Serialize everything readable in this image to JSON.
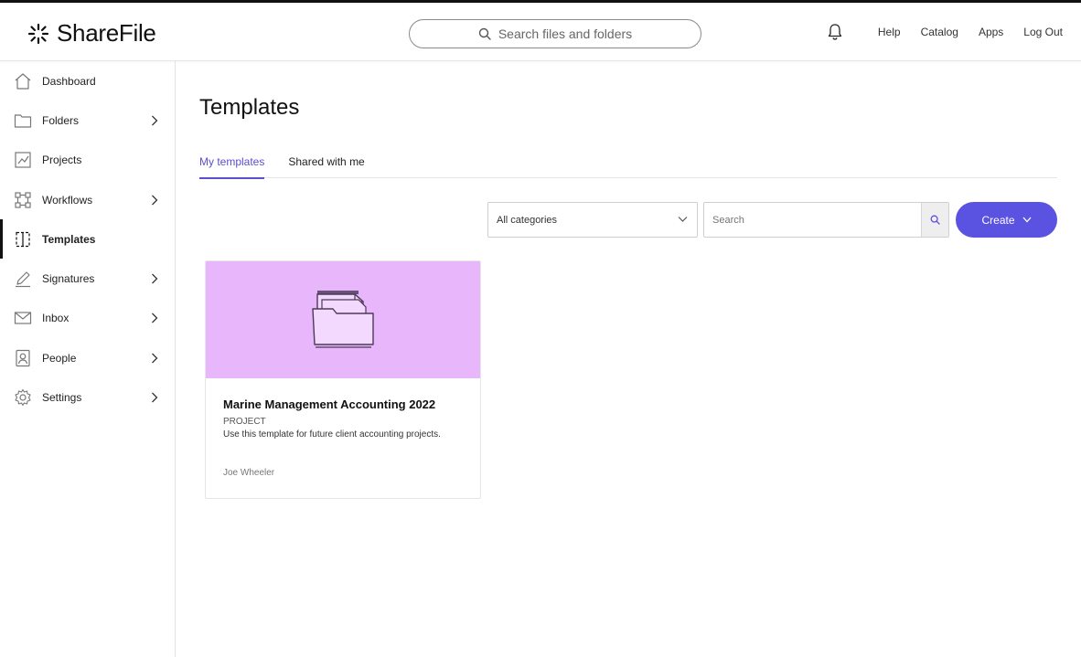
{
  "header": {
    "logo_text": "ShareFile",
    "search_placeholder": "Search files and folders",
    "links": [
      "Help",
      "Catalog",
      "Apps",
      "Log Out"
    ]
  },
  "sidebar": {
    "items": [
      {
        "label": "Dashboard",
        "icon": "home-icon",
        "has_chevron": false
      },
      {
        "label": "Folders",
        "icon": "folder-icon",
        "has_chevron": true
      },
      {
        "label": "Projects",
        "icon": "projects-icon",
        "has_chevron": false
      },
      {
        "label": "Workflows",
        "icon": "workflow-icon",
        "has_chevron": true
      },
      {
        "label": "Templates",
        "icon": "templates-icon",
        "has_chevron": false,
        "active": true
      },
      {
        "label": "Signatures",
        "icon": "signature-pen-icon",
        "has_chevron": true
      },
      {
        "label": "Inbox",
        "icon": "mail-icon",
        "has_chevron": true
      },
      {
        "label": "People",
        "icon": "person-badge-icon",
        "has_chevron": true
      },
      {
        "label": "Settings",
        "icon": "gear-icon",
        "has_chevron": true
      }
    ]
  },
  "main": {
    "title": "Templates",
    "tabs": [
      {
        "label": "My templates",
        "active": true
      },
      {
        "label": "Shared with me",
        "active": false
      }
    ],
    "filter": {
      "category_value": "All categories",
      "search_placeholder": "Search",
      "create_label": "Create"
    },
    "cards": [
      {
        "title": "Marine Management Accounting 2022",
        "type": "PROJECT",
        "description": "Use this template for future client accounting projects.",
        "owner": "Joe Wheeler",
        "banner_color": "#e8b6fa"
      }
    ]
  },
  "colors": {
    "accent": "#5a52e0",
    "tab_active": "#5a4fd0",
    "card_banner": "#e8b6fa"
  }
}
